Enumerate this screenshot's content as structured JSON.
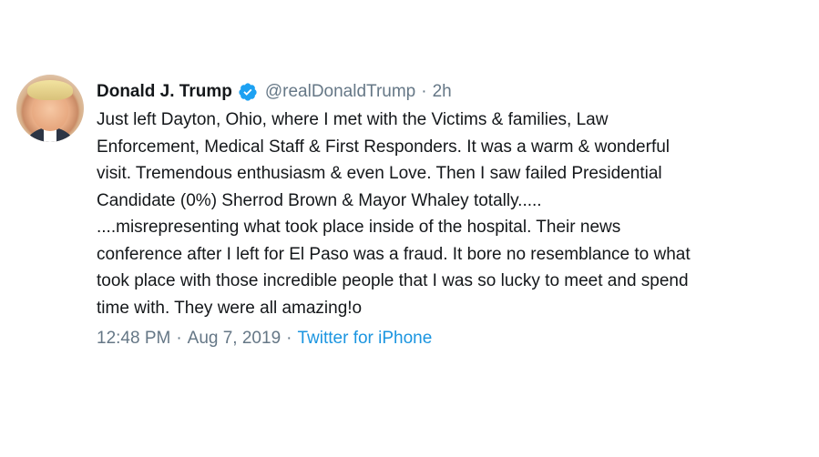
{
  "tweet": {
    "author": {
      "name": "Donald J. Trump",
      "handle": "@realDonaldTrump",
      "verified": true,
      "avatar_icon": "profile-photo"
    },
    "separator": "·",
    "relative_time": "2h",
    "text": {
      "lines": [
        "Just left Dayton, Ohio, where I met with the Victims & families, Law",
        "Enforcement, Medical Staff & First Responders. It was a warm & wonderful",
        "visit. Tremendous enthusiasm & even Love. Then I saw failed Presidential",
        "Candidate (0%) Sherrod Brown & Mayor Whaley totally.....",
        "....misrepresenting what took place inside of the hospital. Their news",
        "conference after I left for El Paso was a fraud. It bore no resemblance to what",
        "took place with those incredible people that I was so lucky to meet and spend",
        "time with. They were all amazing!o"
      ]
    },
    "meta": {
      "time": "12:48 PM",
      "date": "Aug 7, 2019",
      "source": "Twitter for iPhone"
    },
    "colors": {
      "text": "#14171a",
      "secondary": "#657786",
      "link": "#1b95e0",
      "verified_badge": "#1da1f2"
    }
  }
}
